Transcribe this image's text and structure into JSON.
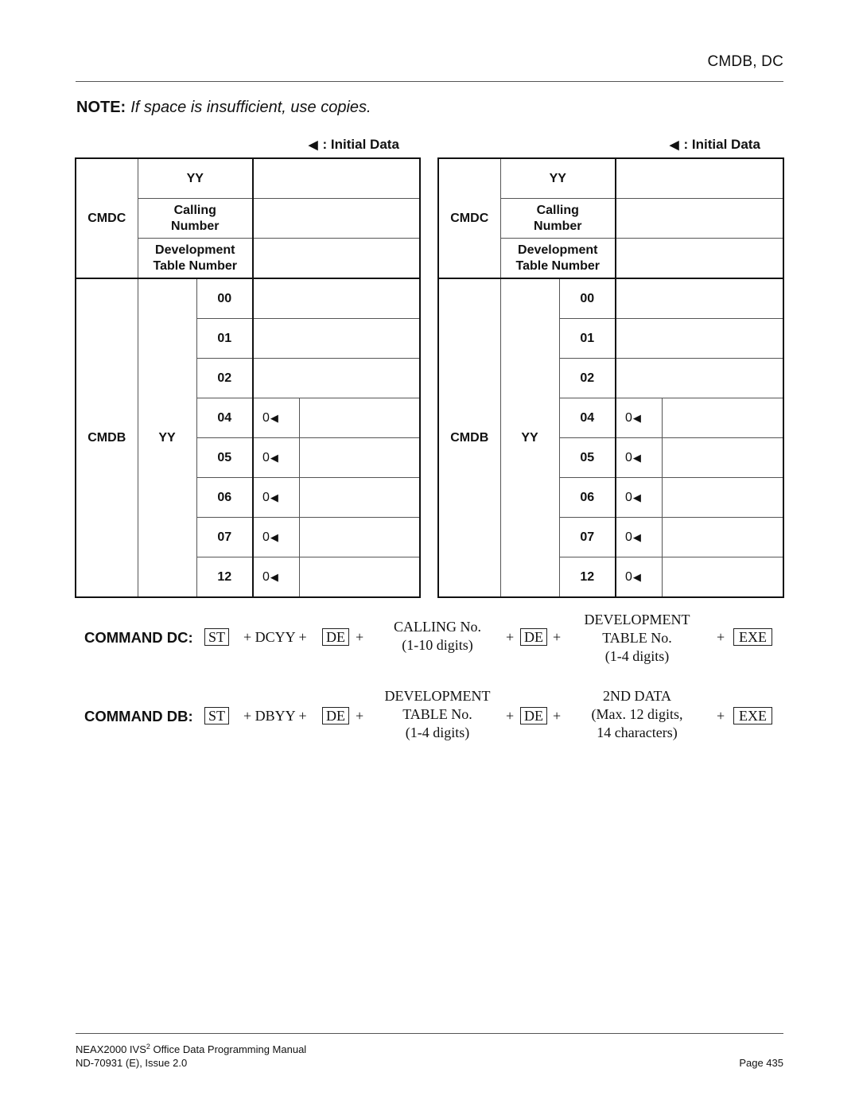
{
  "header": {
    "section_title": "CMDB, DC"
  },
  "note": {
    "label": "NOTE:",
    "text": "If space is insufficient, use copies."
  },
  "legend": {
    "symbol": "◀",
    "label": ": Initial Data"
  },
  "tables": [
    {
      "cmdc": {
        "label": "CMDC",
        "fields": [
          {
            "label": "YY",
            "value": ""
          },
          {
            "label": "Calling Number",
            "value": ""
          },
          {
            "label": "Development Table Number",
            "value": ""
          }
        ]
      },
      "cmdb": {
        "label": "CMDB",
        "param": "YY",
        "rows": [
          {
            "yy": "00",
            "initial": "",
            "value": ""
          },
          {
            "yy": "01",
            "initial": "",
            "value": ""
          },
          {
            "yy": "02",
            "initial": "",
            "value": ""
          },
          {
            "yy": "04",
            "initial": "0",
            "value": ""
          },
          {
            "yy": "05",
            "initial": "0",
            "value": ""
          },
          {
            "yy": "06",
            "initial": "0",
            "value": ""
          },
          {
            "yy": "07",
            "initial": "0",
            "value": ""
          },
          {
            "yy": "12",
            "initial": "0",
            "value": ""
          }
        ]
      }
    },
    {
      "cmdc": {
        "label": "CMDC",
        "fields": [
          {
            "label": "YY",
            "value": ""
          },
          {
            "label": "Calling Number",
            "value": ""
          },
          {
            "label": "Development Table Number",
            "value": ""
          }
        ]
      },
      "cmdb": {
        "label": "CMDB",
        "param": "YY",
        "rows": [
          {
            "yy": "00",
            "initial": "",
            "value": ""
          },
          {
            "yy": "01",
            "initial": "",
            "value": ""
          },
          {
            "yy": "02",
            "initial": "",
            "value": ""
          },
          {
            "yy": "04",
            "initial": "0",
            "value": ""
          },
          {
            "yy": "05",
            "initial": "0",
            "value": ""
          },
          {
            "yy": "06",
            "initial": "0",
            "value": ""
          },
          {
            "yy": "07",
            "initial": "0",
            "value": ""
          },
          {
            "yy": "12",
            "initial": "0",
            "value": ""
          }
        ]
      }
    }
  ],
  "commands": {
    "dc": {
      "label": "COMMAND DC:",
      "st": "ST",
      "code": "+ DCYY +",
      "de": "DE",
      "plus": "+",
      "param1": [
        "CALLING No.",
        "(1-10 digits)"
      ],
      "param2": [
        "DEVELOPMENT",
        "TABLE No.",
        "(1-4 digits)"
      ],
      "exe": "EXE"
    },
    "db": {
      "label": "COMMAND DB:",
      "st": "ST",
      "code": "+ DBYY +",
      "de": "DE",
      "plus": "+",
      "param1": [
        "DEVELOPMENT",
        "TABLE No.",
        "(1-4 digits)"
      ],
      "param2": [
        "2ND DATA",
        "(Max. 12 digits,",
        "14 characters)"
      ],
      "exe": "EXE"
    }
  },
  "footer": {
    "manual_title_pre": "NEAX2000 IVS",
    "manual_title_sup": "2",
    "manual_title_post": " Office Data Programming Manual",
    "doc_number": "ND-70931 (E), Issue 2.0",
    "page": "Page 435"
  }
}
